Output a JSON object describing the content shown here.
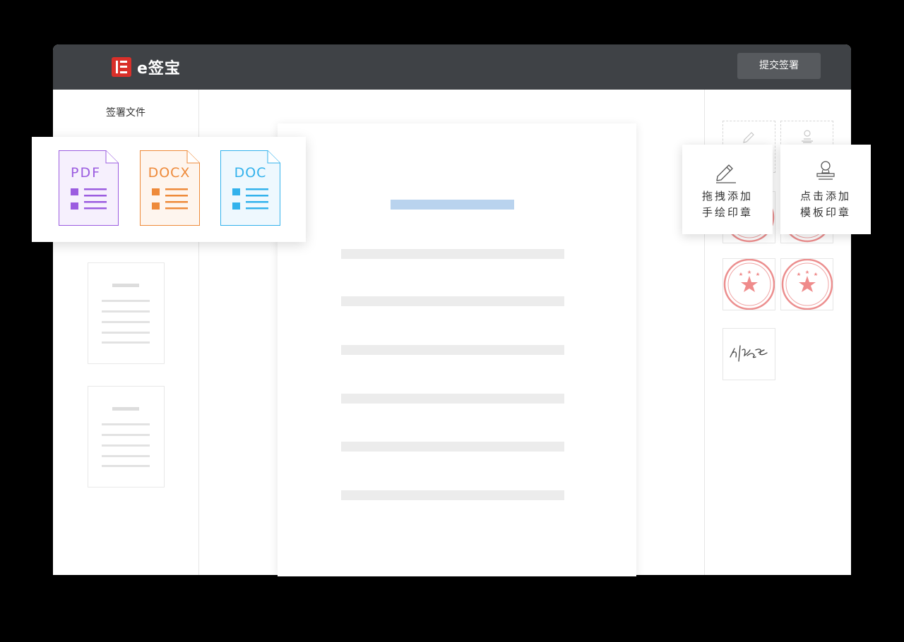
{
  "app": {
    "logo_text": "e签宝",
    "submit_label": "提交签署"
  },
  "sidebar": {
    "title": "签署文件"
  },
  "file_types": [
    {
      "label": "PDF",
      "color": "#9b5ce0",
      "fill": "#f6f0fd"
    },
    {
      "label": "DOCX",
      "color": "#ee8a3a",
      "fill": "#fef5ee"
    },
    {
      "label": "DOC",
      "color": "#33b2ec",
      "fill": "#eef8fe"
    }
  ],
  "actions": {
    "hand_drawn": {
      "line1": "拖拽添加",
      "line2": "手绘印章",
      "icon": "pencil-icon"
    },
    "template": {
      "line1": "点击添加",
      "line2": "模板印章",
      "icon": "stamp-icon"
    }
  },
  "stamp_color": "#ec8e8e",
  "colors": {
    "header_bg": "#3f4246",
    "brand_red": "#d9302a"
  }
}
